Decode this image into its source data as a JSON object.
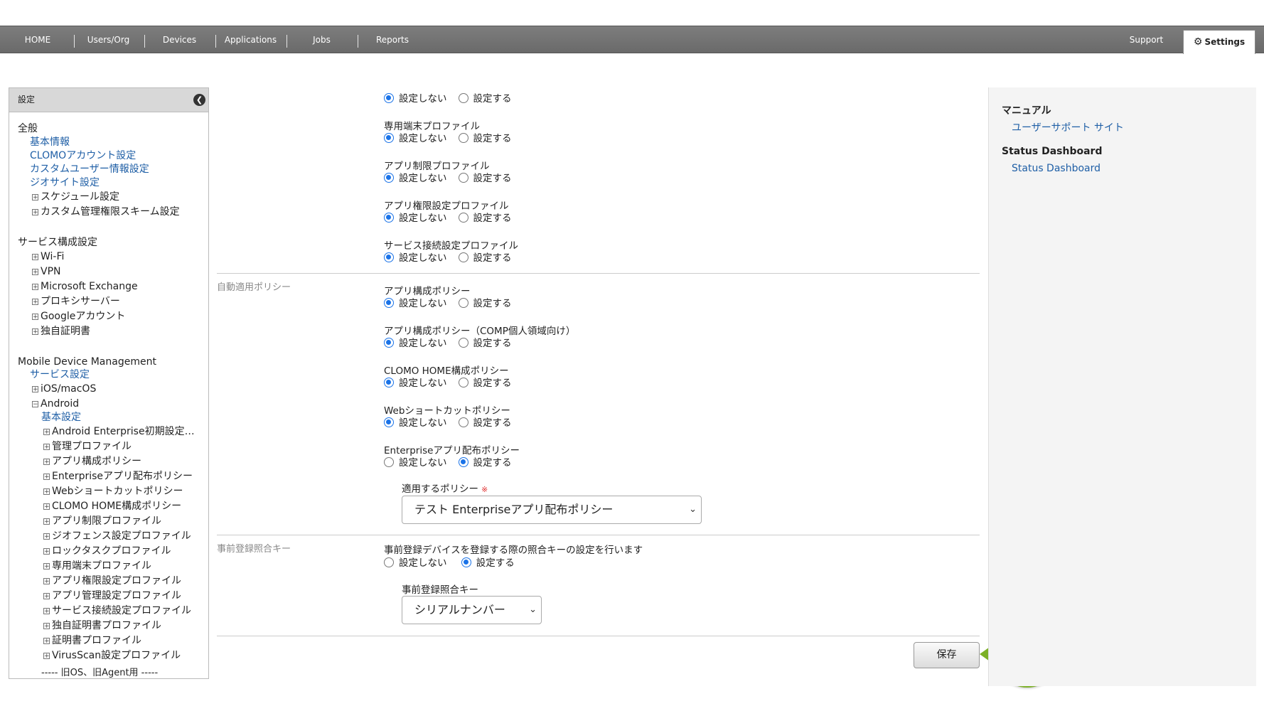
{
  "nav": {
    "items": [
      "HOME",
      "Users/Org",
      "Devices",
      "Applications",
      "Jobs",
      "Reports"
    ],
    "support": "Support",
    "settings": "Settings"
  },
  "sidebar": {
    "header": "設定",
    "general": {
      "title": "全般",
      "links": [
        "基本情報",
        "CLOMOアカウント設定",
        "カスタムユーザー情報設定",
        "ジオサイト設定"
      ],
      "expandables": [
        "スケジュール設定",
        "カスタム管理権限スキーム設定"
      ]
    },
    "service": {
      "title": "サービス構成設定",
      "items": [
        "Wi-Fi",
        "VPN",
        "Microsoft Exchange",
        "プロキシサーバー",
        "Googleアカウント",
        "独自証明書"
      ]
    },
    "mdm": {
      "title": "Mobile Device Management",
      "service_link": "サービス設定",
      "ios": "iOS/macOS",
      "android": "Android",
      "basic": "基本設定",
      "android_items": [
        "Android Enterprise初期設定…",
        "管理プロファイル",
        "アプリ構成ポリシー",
        "Enterpriseアプリ配布ポリシー",
        "Webショートカットポリシー",
        "CLOMO HOME構成ポリシー",
        "アプリ制限プロファイル",
        "ジオフェンス設定プロファイル",
        "ロックタスクプロファイル",
        "専用端末プロファイル",
        "アプリ権限設定プロファイル",
        "アプリ管理設定プロファイル",
        "サービス接続設定プロファイル",
        "独自証明書プロファイル",
        "証明書プロファイル",
        "VirusScan設定プロファイル"
      ],
      "legacy": "----- 旧OS、旧Agent用 -----"
    }
  },
  "form": {
    "option_off": "設定しない",
    "option_on": "設定する",
    "top_rows": [
      {
        "label": "",
        "selected": "off"
      },
      {
        "label": "専用端末プロファイル",
        "selected": "off"
      },
      {
        "label": "アプリ制限プロファイル",
        "selected": "off"
      },
      {
        "label": "アプリ権限設定プロファイル",
        "selected": "off"
      },
      {
        "label": "サービス接続設定プロファイル",
        "selected": "off"
      }
    ],
    "auto_policy": {
      "section": "自動適用ポリシー",
      "rows": [
        {
          "label": "アプリ構成ポリシー",
          "selected": "off"
        },
        {
          "label": "アプリ構成ポリシー（COMP個人領域向け）",
          "selected": "off"
        },
        {
          "label": "CLOMO HOME構成ポリシー",
          "selected": "off"
        },
        {
          "label": "Webショートカットポリシー",
          "selected": "off"
        },
        {
          "label": "Enterpriseアプリ配布ポリシー",
          "selected": "on"
        }
      ],
      "apply_policy_label": "適用するポリシー",
      "required_mark": "※",
      "apply_policy_value": "テスト Enterpriseアプリ配布ポリシー"
    },
    "prereg": {
      "section": "事前登録照合キー",
      "description": "事前登録デバイスを登録する際の照合キーの設定を行います",
      "selected": "on",
      "key_label": "事前登録照合キー",
      "key_value": "シリアルナンバー"
    },
    "save": "保存",
    "step": "6"
  },
  "right_panel": {
    "manual_title": "マニュアル",
    "manual_link": "ユーザーサポート サイト",
    "status_title": "Status Dashboard",
    "status_link": "Status Dashboard"
  },
  "colors": {
    "accent": "#1a73e8",
    "link": "#1f5fa6",
    "badge": "#7cb026",
    "nav": "#6e6e6e"
  }
}
